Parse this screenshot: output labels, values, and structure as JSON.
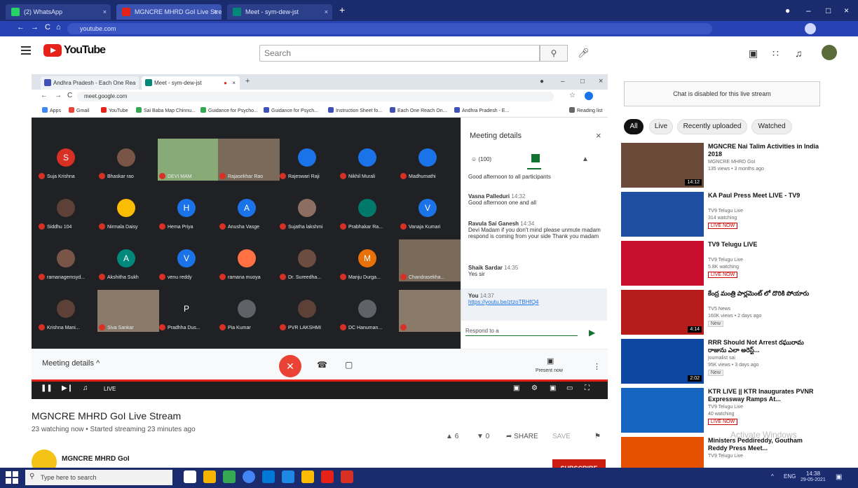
{
  "host_browser": {
    "tabs": [
      {
        "title": "(2) WhatsApp",
        "fav_color": "#25d366"
      },
      {
        "title": "MGNCRE MHRD GoI Live Stream",
        "fav_color": "#e62117"
      },
      {
        "title": "Meet - sym-dew-jst",
        "fav_color": "#00897b"
      }
    ],
    "url": "youtube.com"
  },
  "youtube": {
    "logo_text": "YouTube",
    "search_placeholder": "Search"
  },
  "inner_browser": {
    "tabs": [
      "Andhra Pradesh - Each One Rea",
      "Meet - sym-dew-jst"
    ],
    "url": "meet.google.com",
    "bookmarks": [
      {
        "label": "Apps",
        "color": "#4285f4"
      },
      {
        "label": "Gmail",
        "color": "#ea4335"
      },
      {
        "label": "YouTube",
        "color": "#e62117"
      },
      {
        "label": "Sai Baba Map Chinnu...",
        "color": "#34a853"
      },
      {
        "label": "Guidance for Psycho...",
        "color": "#34a853"
      },
      {
        "label": "Guidance for Psych...",
        "color": "#3f51b5"
      },
      {
        "label": "Instruction Sheet fo...",
        "color": "#3f51b5"
      },
      {
        "label": "Each One Reach On...",
        "color": "#3f51b5"
      },
      {
        "label": "Andhra Pradesh - E...",
        "color": "#3f51b5"
      },
      {
        "label": "Reading list",
        "color": "#666"
      }
    ]
  },
  "meet": {
    "participants": [
      {
        "initial": "S",
        "name": "Suja Krishna",
        "color": "#d93025"
      },
      {
        "initial": "",
        "name": "Bhaskar rao",
        "color": "#795548"
      },
      {
        "initial": "",
        "name": "DEVI MAM",
        "color": "#8a7",
        "video": true
      },
      {
        "initial": "",
        "name": "Rajasekhar Rao",
        "color": "#7a6a5a",
        "video": true
      },
      {
        "initial": "",
        "name": "Rajeswari Raji",
        "color": "#1a73e8"
      },
      {
        "initial": "",
        "name": "Nikhil Murali",
        "color": "#1a73e8"
      },
      {
        "initial": "",
        "name": "Madhumathi",
        "color": "#1a73e8"
      },
      {
        "initial": "",
        "name": "Siddhu 104",
        "color": "#5d4037"
      },
      {
        "initial": "",
        "name": "Nirmala Daisy",
        "color": "#fbbc04"
      },
      {
        "initial": "H",
        "name": "Hema Priya",
        "color": "#1a73e8"
      },
      {
        "initial": "A",
        "name": "Anusha Vasge",
        "color": "#1a73e8"
      },
      {
        "initial": "",
        "name": "Sujatha lakshmi",
        "color": "#8d6e63"
      },
      {
        "initial": "",
        "name": "Prabhakar Ra...",
        "color": "#00796b"
      },
      {
        "initial": "V",
        "name": "Vanaja Kumari",
        "color": "#1a73e8"
      },
      {
        "initial": "",
        "name": "ramanagemsyd...",
        "color": "#795548"
      },
      {
        "initial": "A",
        "name": "Akshitha Sukh",
        "color": "#00897b"
      },
      {
        "initial": "V",
        "name": "venu reddy",
        "color": "#1a73e8"
      },
      {
        "initial": "",
        "name": "ramana muoya",
        "color": "#ff7043"
      },
      {
        "initial": "",
        "name": "Dr. Sureedha...",
        "color": "#6d4c41"
      },
      {
        "initial": "M",
        "name": "Manju Durga...",
        "color": "#e8710a"
      },
      {
        "initial": "",
        "name": "Chandrasekha...",
        "color": "#7a6a5a",
        "video": true
      },
      {
        "initial": "",
        "name": "Krishna Mani...",
        "color": "#5d4037"
      },
      {
        "initial": "",
        "name": "Siva Sankar",
        "color": "#8a7a6a",
        "video": true
      },
      {
        "initial": "P",
        "name": "Pradhha Dus...",
        "color": "#202124"
      },
      {
        "initial": "",
        "name": "Pia Kumar",
        "color": "#5f6368"
      },
      {
        "initial": "",
        "name": "PVR LAKSHMI",
        "color": "#5d4037"
      },
      {
        "initial": "",
        "name": "DC Hanuman...",
        "color": "#5f6368"
      },
      {
        "initial": "",
        "name": "",
        "color": "#8a7a6a",
        "video": true
      }
    ],
    "panel": {
      "title": "Meeting details",
      "people_count": "(100)",
      "pinned_msg": "Good afternoon to all participants",
      "messages": [
        {
          "author": "Vasna Palleduri",
          "time": "14:32",
          "text": "Good afternoon one and all"
        },
        {
          "author": "Ravula Sai Ganesh",
          "time": "14:34",
          "text": "Devi Madam if you don't mind please unmute madam respond is coming from your side Thank you madam"
        },
        {
          "author": "Shaik Sardar",
          "time": "14:35",
          "text": "Yes sir"
        },
        {
          "author": "You",
          "time": "14:37",
          "text": "https://youtu.be/ztzoTBHfQ4"
        }
      ],
      "input_placeholder": "Respond to a"
    },
    "bottom_label": "Meeting details",
    "present_now": "Present now"
  },
  "player": {
    "live_label": "LIVE"
  },
  "video": {
    "title": "MGNCRE MHRD GoI Live Stream",
    "meta": "23 watching now • Started streaming 23 minutes ago",
    "likes": "6",
    "dislikes": "0",
    "share": "SHARE",
    "save": "SAVE",
    "channel": "MGNCRE MHRD GoI",
    "subscribe": "SUBSCRIBE"
  },
  "sidebar": {
    "chat_disabled": "Chat is disabled for this live stream",
    "chips": [
      "All",
      "Live",
      "Recently uploaded",
      "Watched"
    ],
    "recommendations": [
      {
        "title": "MGNCRE Nai Talim Activities in India 2018",
        "channel": "MGNCRE MHRD GoI",
        "meta": "135 views • 3 months ago",
        "duration": "14:12",
        "badge": "",
        "thumb": "#6b4a3a"
      },
      {
        "title": "KA Paul Press Meet LIVE - TV9",
        "channel": "TV9 Telugu Live",
        "meta": "314 watching",
        "duration": "",
        "badge": "LIVE NOW",
        "thumb": "#1f4fa0"
      },
      {
        "title": "TV9 Telugu LIVE",
        "channel": "TV9 Telugu Live",
        "meta": "5.8K watching",
        "duration": "",
        "badge": "LIVE NOW",
        "thumb": "#c8102e"
      },
      {
        "title": "కేంద్ర మంత్రి పార్లమెంట్ లో దొరికి పోయారు",
        "channel": "TV5 News",
        "meta": "160K views • 2 days ago",
        "duration": "4:14",
        "badge": "New",
        "thumb": "#b71c1c"
      },
      {
        "title": "RRR Should Not Arrest రఘురామ రాజును ఎలా అరెస్ట్...",
        "channel": "journalist sai",
        "meta": "95K views • 3 days ago",
        "duration": "2:02",
        "badge": "New",
        "thumb": "#0d47a1"
      },
      {
        "title": "KTR LIVE || KTR Inaugurates PVNR Expressway Ramps At...",
        "channel": "TV9 Telugu Live",
        "meta": "40 watching",
        "duration": "",
        "badge": "LIVE NOW",
        "thumb": "#1565c0"
      },
      {
        "title": "Ministers Peddireddy, Goutham Reddy Press Meet...",
        "channel": "TV9 Telugu Live",
        "meta": "",
        "duration": "",
        "badge": "",
        "thumb": "#e65100"
      }
    ]
  },
  "taskbar": {
    "search_placeholder": "Type here to search",
    "lang": "ENG",
    "time": "14:38",
    "date": "29-05-2021"
  },
  "watermark": "Activate Windows"
}
